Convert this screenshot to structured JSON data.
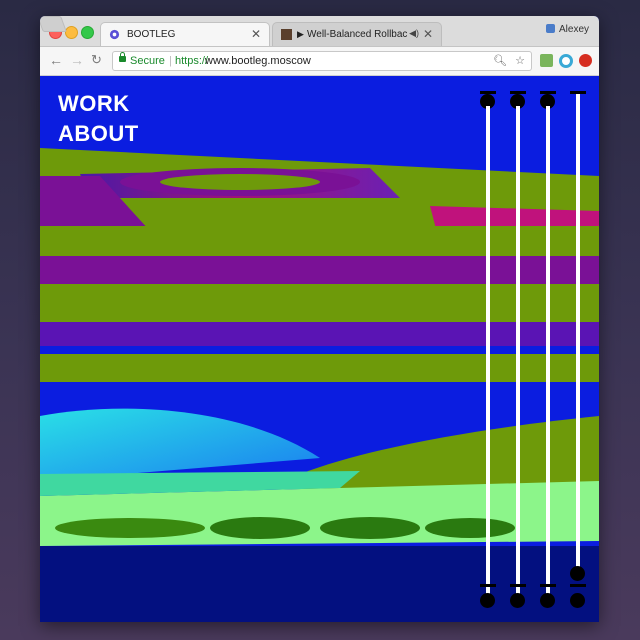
{
  "browser": {
    "tabs": [
      {
        "title": "BOOTLEG",
        "active": true
      },
      {
        "title": "Well-Balanced Rollback",
        "active": false
      }
    ],
    "profile_name": "Alexey",
    "address": {
      "secure_label": "Secure",
      "scheme": "https://",
      "host": "www.bootleg.moscow"
    },
    "icons": {
      "back": "back-arrow-icon",
      "forward": "forward-arrow-icon",
      "reload": "reload-icon",
      "zoom": "zoom-icon",
      "bookmark": "star-icon",
      "close": "close-icon",
      "audio": "speaker-icon",
      "play": "play-icon"
    }
  },
  "site": {
    "nav": {
      "work": "WORK",
      "about": "ABOUT"
    },
    "colors": {
      "background": "#0b1de0",
      "green": "#6e9a0a",
      "magenta": "#7a1196",
      "mint": "#8cf58a",
      "cyan": "#25d8de",
      "navy": "#031080"
    },
    "sliders_count": 4
  }
}
